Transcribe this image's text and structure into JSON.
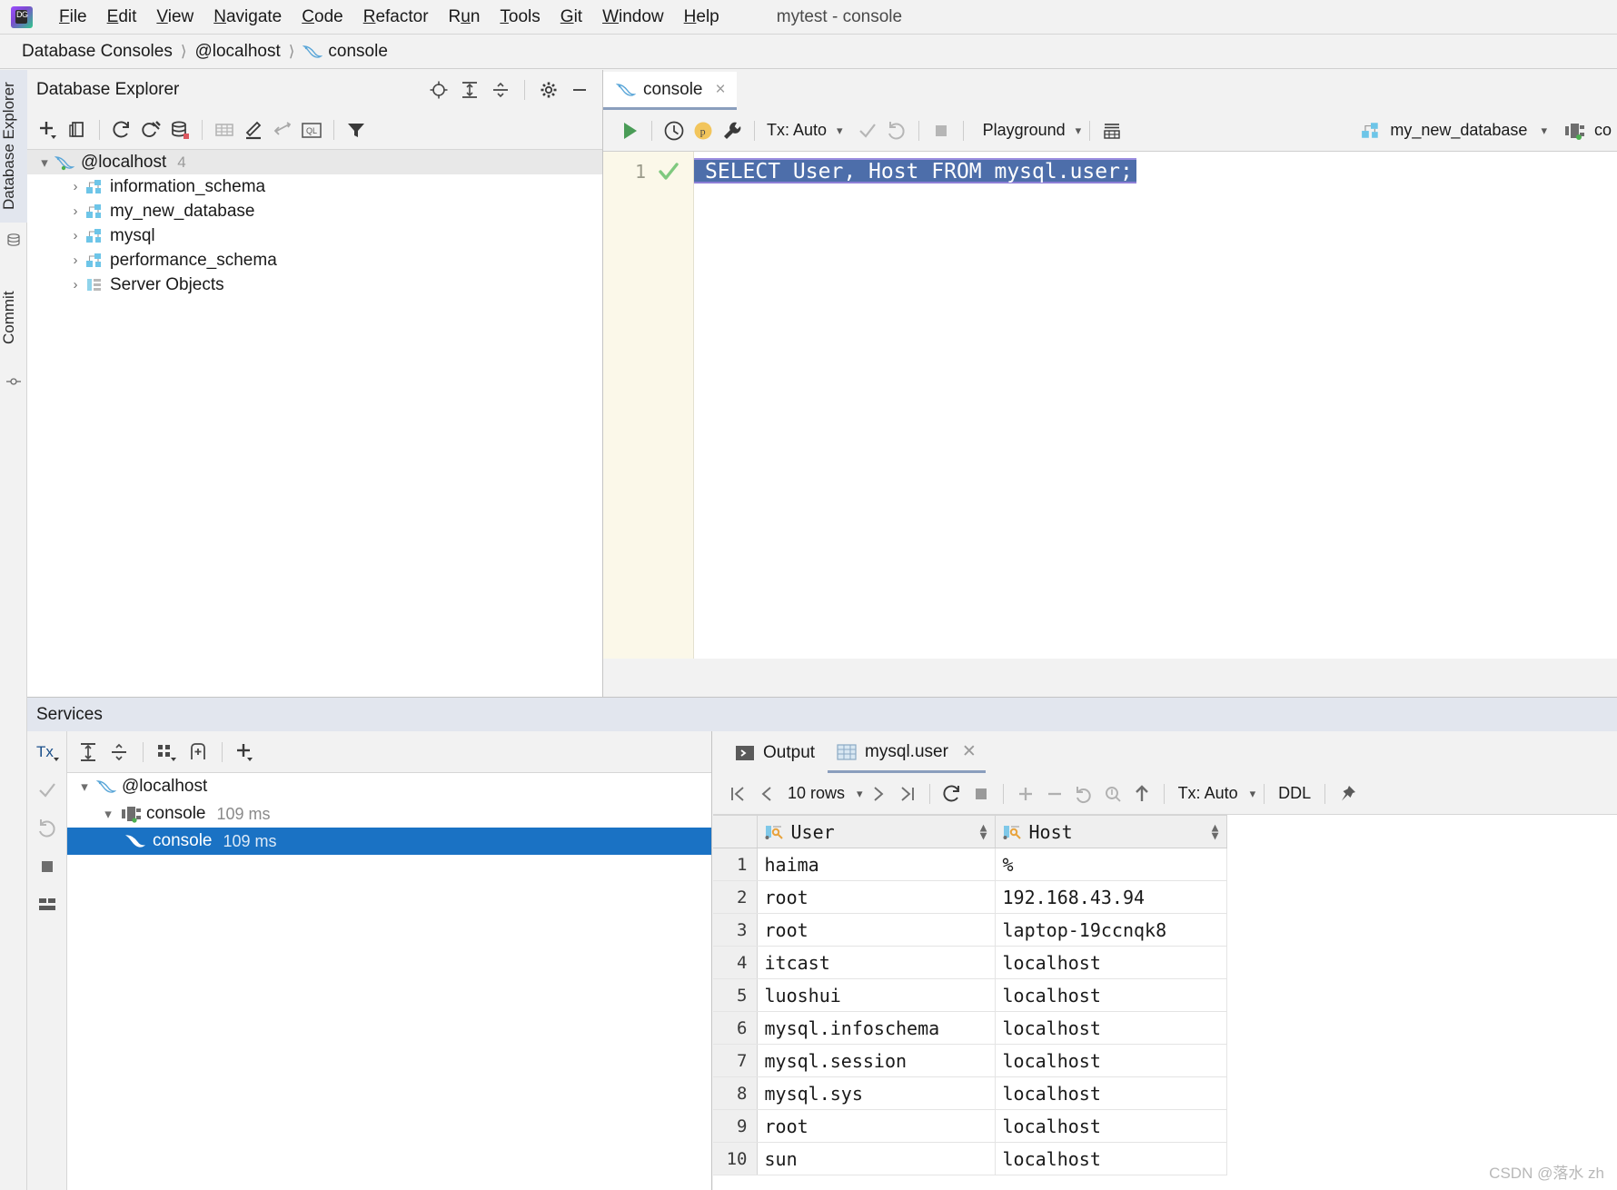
{
  "window": {
    "title": "mytest - console"
  },
  "menu": {
    "items": [
      {
        "label": "File",
        "mnemonic": "F"
      },
      {
        "label": "Edit",
        "mnemonic": "E"
      },
      {
        "label": "View",
        "mnemonic": "V"
      },
      {
        "label": "Navigate",
        "mnemonic": "N"
      },
      {
        "label": "Code",
        "mnemonic": "C"
      },
      {
        "label": "Refactor",
        "mnemonic": "R"
      },
      {
        "label": "Run",
        "mnemonic": "u"
      },
      {
        "label": "Tools",
        "mnemonic": "T"
      },
      {
        "label": "Git",
        "mnemonic": "G"
      },
      {
        "label": "Window",
        "mnemonic": "W"
      },
      {
        "label": "Help",
        "mnemonic": "H"
      }
    ]
  },
  "breadcrumb": {
    "items": [
      "Database Consoles",
      "@localhost",
      "console"
    ]
  },
  "tool_strips": {
    "left_top": "Database Explorer",
    "left_bottom": "Commit"
  },
  "db_explorer": {
    "title": "Database Explorer",
    "header_icons": [
      "locate-icon",
      "expand-all-icon",
      "collapse-all-icon",
      "gear-icon",
      "minimize-icon"
    ],
    "toolbar_icons": [
      "add-icon",
      "copy-icon",
      "refresh-icon",
      "sync-modify-icon",
      "database-error-icon",
      "table-icon",
      "edit-icon",
      "jump-to-icon",
      "query-console-icon",
      "filter-icon"
    ],
    "tree": {
      "root": {
        "label": "@localhost",
        "count": "4"
      },
      "children": [
        {
          "label": "information_schema",
          "icon": "schema-icon"
        },
        {
          "label": "my_new_database",
          "icon": "schema-icon"
        },
        {
          "label": "mysql",
          "icon": "schema-icon"
        },
        {
          "label": "performance_schema",
          "icon": "schema-icon"
        },
        {
          "label": "Server Objects",
          "icon": "server-objects-icon"
        }
      ]
    }
  },
  "editor": {
    "tab": {
      "label": "console",
      "icon": "mysql-dolphin-icon",
      "close": "×"
    },
    "toolbar": {
      "run_icon": "run-icon",
      "history_icon": "history-icon",
      "profile_icon": "profile-p-icon",
      "settings_icon": "wrench-icon",
      "tx_label": "Tx: Auto",
      "commit_icon": "commit-check-icon",
      "rollback_icon": "rollback-icon",
      "stop_icon": "stop-icon",
      "session_label": "Playground",
      "grid_icon": "data-grid-icon",
      "schema_label": "my_new_database",
      "connection_label": "co"
    },
    "gutter": {
      "line_number": "1",
      "status_icon": "success-check-icon"
    },
    "code": {
      "selected_sql": "SELECT User, Host FROM mysql.user;"
    }
  },
  "services": {
    "title": "Services",
    "side_icons": [
      "tx-icon",
      "commit-check-icon",
      "rollback-icon",
      "stop-icon",
      "grid-view-icon"
    ],
    "toolbar_icons": [
      "expand-all-icon",
      "collapse-all-icon",
      "group-by-icon",
      "add-frame-icon",
      "add-icon"
    ],
    "tree": [
      {
        "label": "@localhost",
        "time": "",
        "icon": "mysql-dolphin-icon",
        "level": 0,
        "selected": false,
        "expanded": true
      },
      {
        "label": "console",
        "time": "109 ms",
        "icon": "connection-icon",
        "level": 1,
        "selected": false,
        "expanded": true
      },
      {
        "label": "console",
        "time": "109 ms",
        "icon": "mysql-dolphin-icon",
        "level": 2,
        "selected": true,
        "expanded": false
      }
    ]
  },
  "results": {
    "tabs": [
      {
        "label": "Output",
        "icon": "output-icon",
        "active": false,
        "closable": false
      },
      {
        "label": "mysql.user",
        "icon": "table-icon",
        "active": true,
        "closable": true
      }
    ],
    "toolbar": {
      "first_page_icon": "first-page-icon",
      "prev_page_icon": "prev-page-icon",
      "rows_label": "10 rows",
      "next_page_icon": "next-page-icon",
      "last_page_icon": "last-page-icon",
      "reload_icon": "reload-icon",
      "stop_icon": "stop-icon",
      "add_row_icon": "add-row-icon",
      "delete_row_icon": "delete-row-icon",
      "revert_icon": "revert-icon",
      "find_icon": "find-icon",
      "submit_icon": "submit-icon",
      "tx_label": "Tx: Auto",
      "ddl_label": "DDL",
      "pin_icon": "pin-icon"
    },
    "grid": {
      "columns": [
        {
          "label": "User",
          "icon": "primary-key-icon"
        },
        {
          "label": "Host",
          "icon": "primary-key-icon"
        }
      ],
      "rows": [
        {
          "n": "1",
          "User": "haima",
          "Host": "%"
        },
        {
          "n": "2",
          "User": "root",
          "Host": "192.168.43.94"
        },
        {
          "n": "3",
          "User": "root",
          "Host": "laptop-19ccnqk8"
        },
        {
          "n": "4",
          "User": "itcast",
          "Host": "localhost"
        },
        {
          "n": "5",
          "User": "luoshui",
          "Host": "localhost"
        },
        {
          "n": "6",
          "User": "mysql.infoschema",
          "Host": "localhost"
        },
        {
          "n": "7",
          "User": "mysql.session",
          "Host": "localhost"
        },
        {
          "n": "8",
          "User": "mysql.sys",
          "Host": "localhost"
        },
        {
          "n": "9",
          "User": "root",
          "Host": "localhost"
        },
        {
          "n": "10",
          "User": "sun",
          "Host": "localhost"
        }
      ]
    }
  },
  "watermark": "CSDN @落水 zh",
  "colors": {
    "accent_blue": "#1a72c4",
    "selection_blue": "#4d6eaa",
    "schema_icon": "#63c6e8",
    "run_green": "#59a869",
    "gutter_bg": "#fbf8e9",
    "services_header": "#e2e6ee"
  }
}
